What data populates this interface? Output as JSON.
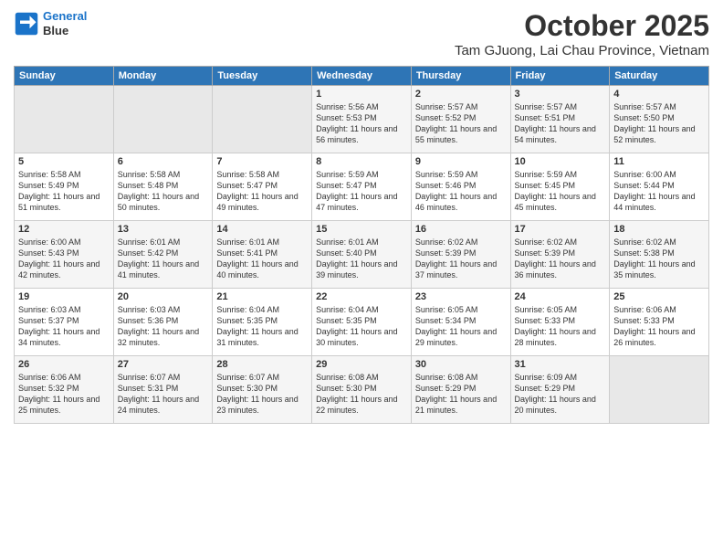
{
  "logo": {
    "line1": "General",
    "line2": "Blue"
  },
  "title": "October 2025",
  "location": "Tam GJuong, Lai Chau Province, Vietnam",
  "days_header": [
    "Sunday",
    "Monday",
    "Tuesday",
    "Wednesday",
    "Thursday",
    "Friday",
    "Saturday"
  ],
  "weeks": [
    [
      {
        "num": "",
        "sunrise": "",
        "sunset": "",
        "daylight": ""
      },
      {
        "num": "",
        "sunrise": "",
        "sunset": "",
        "daylight": ""
      },
      {
        "num": "",
        "sunrise": "",
        "sunset": "",
        "daylight": ""
      },
      {
        "num": "1",
        "sunrise": "5:56 AM",
        "sunset": "5:53 PM",
        "daylight": "11 hours and 56 minutes."
      },
      {
        "num": "2",
        "sunrise": "5:57 AM",
        "sunset": "5:52 PM",
        "daylight": "11 hours and 55 minutes."
      },
      {
        "num": "3",
        "sunrise": "5:57 AM",
        "sunset": "5:51 PM",
        "daylight": "11 hours and 54 minutes."
      },
      {
        "num": "4",
        "sunrise": "5:57 AM",
        "sunset": "5:50 PM",
        "daylight": "11 hours and 52 minutes."
      }
    ],
    [
      {
        "num": "5",
        "sunrise": "5:58 AM",
        "sunset": "5:49 PM",
        "daylight": "11 hours and 51 minutes."
      },
      {
        "num": "6",
        "sunrise": "5:58 AM",
        "sunset": "5:48 PM",
        "daylight": "11 hours and 50 minutes."
      },
      {
        "num": "7",
        "sunrise": "5:58 AM",
        "sunset": "5:47 PM",
        "daylight": "11 hours and 49 minutes."
      },
      {
        "num": "8",
        "sunrise": "5:59 AM",
        "sunset": "5:47 PM",
        "daylight": "11 hours and 47 minutes."
      },
      {
        "num": "9",
        "sunrise": "5:59 AM",
        "sunset": "5:46 PM",
        "daylight": "11 hours and 46 minutes."
      },
      {
        "num": "10",
        "sunrise": "5:59 AM",
        "sunset": "5:45 PM",
        "daylight": "11 hours and 45 minutes."
      },
      {
        "num": "11",
        "sunrise": "6:00 AM",
        "sunset": "5:44 PM",
        "daylight": "11 hours and 44 minutes."
      }
    ],
    [
      {
        "num": "12",
        "sunrise": "6:00 AM",
        "sunset": "5:43 PM",
        "daylight": "11 hours and 42 minutes."
      },
      {
        "num": "13",
        "sunrise": "6:01 AM",
        "sunset": "5:42 PM",
        "daylight": "11 hours and 41 minutes."
      },
      {
        "num": "14",
        "sunrise": "6:01 AM",
        "sunset": "5:41 PM",
        "daylight": "11 hours and 40 minutes."
      },
      {
        "num": "15",
        "sunrise": "6:01 AM",
        "sunset": "5:40 PM",
        "daylight": "11 hours and 39 minutes."
      },
      {
        "num": "16",
        "sunrise": "6:02 AM",
        "sunset": "5:39 PM",
        "daylight": "11 hours and 37 minutes."
      },
      {
        "num": "17",
        "sunrise": "6:02 AM",
        "sunset": "5:39 PM",
        "daylight": "11 hours and 36 minutes."
      },
      {
        "num": "18",
        "sunrise": "6:02 AM",
        "sunset": "5:38 PM",
        "daylight": "11 hours and 35 minutes."
      }
    ],
    [
      {
        "num": "19",
        "sunrise": "6:03 AM",
        "sunset": "5:37 PM",
        "daylight": "11 hours and 34 minutes."
      },
      {
        "num": "20",
        "sunrise": "6:03 AM",
        "sunset": "5:36 PM",
        "daylight": "11 hours and 32 minutes."
      },
      {
        "num": "21",
        "sunrise": "6:04 AM",
        "sunset": "5:35 PM",
        "daylight": "11 hours and 31 minutes."
      },
      {
        "num": "22",
        "sunrise": "6:04 AM",
        "sunset": "5:35 PM",
        "daylight": "11 hours and 30 minutes."
      },
      {
        "num": "23",
        "sunrise": "6:05 AM",
        "sunset": "5:34 PM",
        "daylight": "11 hours and 29 minutes."
      },
      {
        "num": "24",
        "sunrise": "6:05 AM",
        "sunset": "5:33 PM",
        "daylight": "11 hours and 28 minutes."
      },
      {
        "num": "25",
        "sunrise": "6:06 AM",
        "sunset": "5:33 PM",
        "daylight": "11 hours and 26 minutes."
      }
    ],
    [
      {
        "num": "26",
        "sunrise": "6:06 AM",
        "sunset": "5:32 PM",
        "daylight": "11 hours and 25 minutes."
      },
      {
        "num": "27",
        "sunrise": "6:07 AM",
        "sunset": "5:31 PM",
        "daylight": "11 hours and 24 minutes."
      },
      {
        "num": "28",
        "sunrise": "6:07 AM",
        "sunset": "5:30 PM",
        "daylight": "11 hours and 23 minutes."
      },
      {
        "num": "29",
        "sunrise": "6:08 AM",
        "sunset": "5:30 PM",
        "daylight": "11 hours and 22 minutes."
      },
      {
        "num": "30",
        "sunrise": "6:08 AM",
        "sunset": "5:29 PM",
        "daylight": "11 hours and 21 minutes."
      },
      {
        "num": "31",
        "sunrise": "6:09 AM",
        "sunset": "5:29 PM",
        "daylight": "11 hours and 20 minutes."
      },
      {
        "num": "",
        "sunrise": "",
        "sunset": "",
        "daylight": ""
      }
    ]
  ]
}
